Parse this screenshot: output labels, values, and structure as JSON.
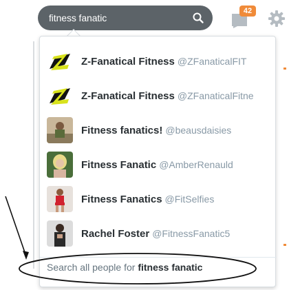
{
  "search": {
    "value": "fitness fanatic"
  },
  "header": {
    "messages_count": "42"
  },
  "results": [
    {
      "name": "Z-Fanatical Fitness",
      "handle": "@ZFanaticalFIT",
      "avatar": "z-logo"
    },
    {
      "name": "Z-Fanatical Fitness",
      "handle": "@ZFanaticalFitne",
      "avatar": "z-logo"
    },
    {
      "name": "Fitness fanatics!",
      "handle": "@beausdaisies",
      "avatar": "photo"
    },
    {
      "name": "Fitness Fanatic",
      "handle": "@AmberRenauld",
      "avatar": "photo"
    },
    {
      "name": "Fitness Fanatics",
      "handle": "@FitSelfies",
      "avatar": "photo"
    },
    {
      "name": "Rachel Foster",
      "handle": "@FitnessFanatic5",
      "avatar": "photo"
    }
  ],
  "search_all": {
    "prefix": "Search all people for ",
    "query": "fitness fanatic"
  },
  "colors": {
    "search_bg": "#5c6368",
    "badge": "#f08b39",
    "handle": "#8899a6"
  }
}
